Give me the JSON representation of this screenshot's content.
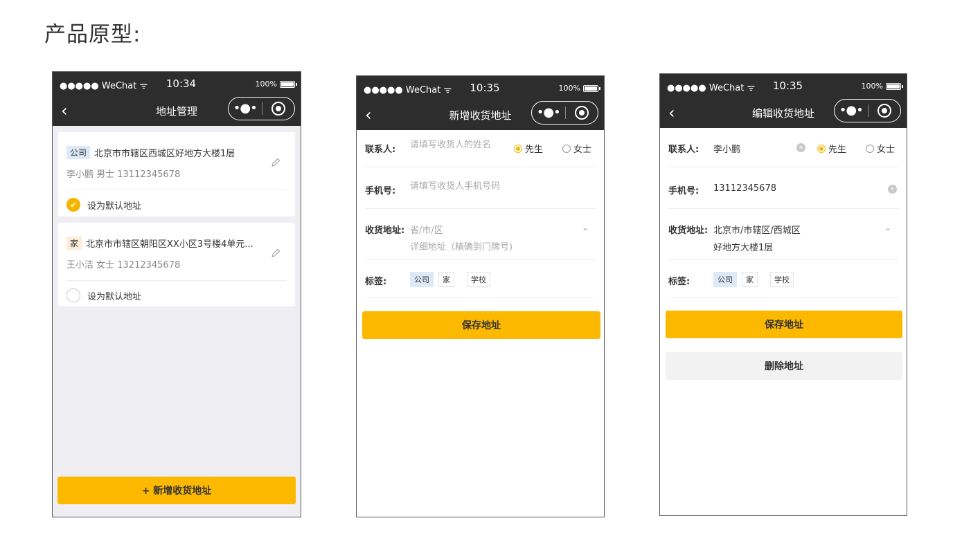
{
  "heading": "产品原型:",
  "status": {
    "carrier": "●●●●● WeChat",
    "battery": "100%"
  },
  "phone1": {
    "time": "10:34",
    "title": "地址管理",
    "cards": [
      {
        "tag": "公司",
        "address": "北京市市辖区西城区好地方大楼1层",
        "contact": "李小鹏 男士  13112345678",
        "default_label": "设为默认地址",
        "is_default": true
      },
      {
        "tag": "家",
        "address": "北京市市辖区朝阳区XX小区3号楼4单元...",
        "contact": "王小洁 女士  13212345678",
        "default_label": "设为默认地址",
        "is_default": false
      }
    ],
    "add_button": "+ 新增收货地址"
  },
  "phone2": {
    "time": "10:35",
    "title": "新增收货地址",
    "contact_label": "联系人:",
    "contact_placeholder": "请填写收货人的姓名",
    "mr": "先生",
    "ms": "女士",
    "phone_label": "手机号:",
    "phone_placeholder": "请填写收货人手机号码",
    "address_label": "收货地址:",
    "region_placeholder": "省/市/区",
    "detail_placeholder": "详细地址（精确到门牌号)",
    "tags_label": "标签:",
    "tags": [
      "公司",
      "家",
      "学校"
    ],
    "save_button": "保存地址"
  },
  "phone3": {
    "time": "10:35",
    "title": "编辑收货地址",
    "contact_label": "联系人:",
    "contact_value": "李小鹏",
    "mr": "先生",
    "ms": "女士",
    "phone_label": "手机号:",
    "phone_value": "13112345678",
    "address_label": "收货地址:",
    "region_value": "北京市/市辖区/西城区",
    "detail_value": "好地方大楼1层",
    "tags_label": "标签:",
    "tags": [
      "公司",
      "家",
      "学校"
    ],
    "save_button": "保存地址",
    "delete_button": "删除地址"
  },
  "colors": {
    "accent": "#fdb900",
    "navbar": "#2d2d2d",
    "tag_company": "#dde9f7",
    "tag_home": "#fdecd8"
  }
}
